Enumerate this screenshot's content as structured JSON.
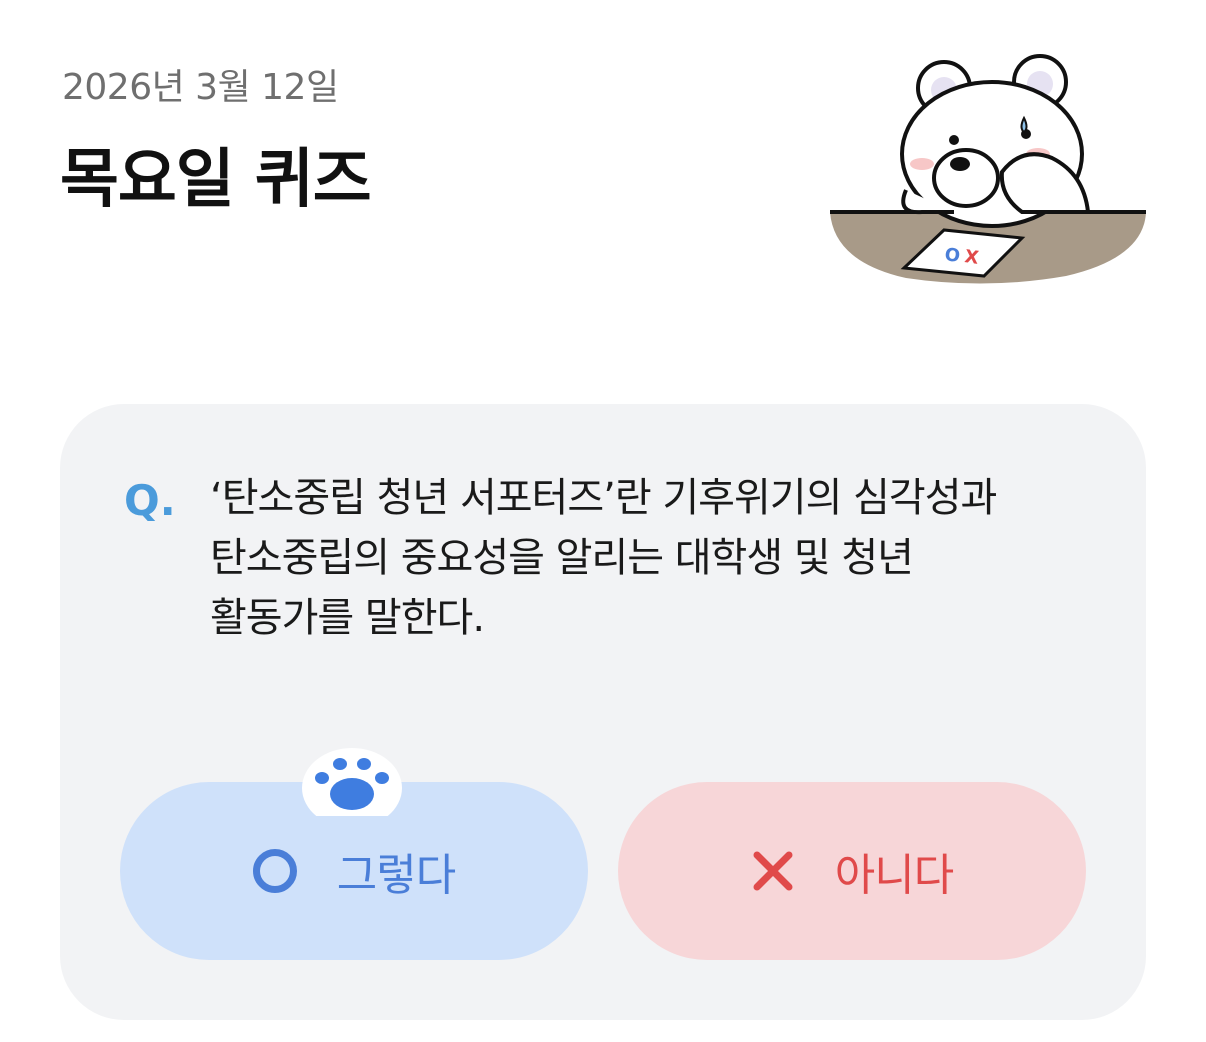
{
  "header": {
    "date": "2026년 3월 12일",
    "title": "목요일 퀴즈"
  },
  "mascot": {
    "icon": "bear-mascot-icon",
    "paper_text": "OX"
  },
  "quiz": {
    "q_label": "Q.",
    "question_lines": [
      "‘탄소중립 청년 서포터즈’란 기후위기의 심각성과",
      "탄소중립의 중요성을 알리는 대학생 및 청년",
      "활동가를 말한다."
    ],
    "yes_label": "그렇다",
    "no_label": "아니다",
    "yes_icon": "circle-o-icon",
    "no_icon": "x-icon",
    "colors": {
      "accent_q": "#4b9bdb",
      "yes_bg": "#cfe1fa",
      "yes_fg": "#4a7ed8",
      "no_bg": "#f7d6d8",
      "no_fg": "#e04a4a",
      "card_bg": "#f2f3f5"
    }
  }
}
